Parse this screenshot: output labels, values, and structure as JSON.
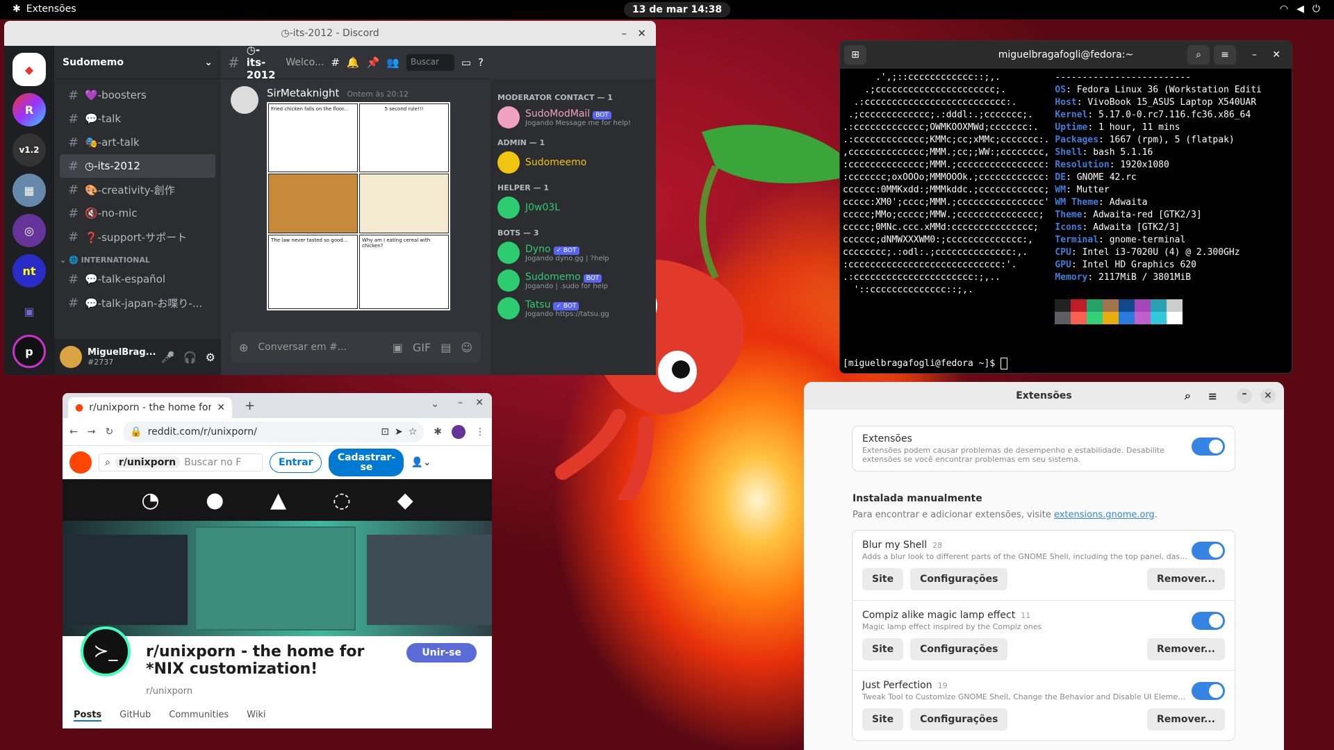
{
  "topbar": {
    "app": "Extensões",
    "clock": "13 de mar  14:38"
  },
  "discord": {
    "title": "◷-its-2012 - Discord",
    "guild": "Sudomemo",
    "channels": [
      "💜-boosters",
      "💬-talk",
      "🎭-art-talk",
      "◷-its-2012",
      "🎨-creativity-創作",
      "🔇-no-mic",
      "❓-support-サポート"
    ],
    "category": "INTERNATIONAL",
    "channels2": [
      "💬-talk-español",
      "💬-talk-japan-お喋り-..."
    ],
    "user": {
      "name": "MiguelBrag...",
      "tag": "#2737"
    },
    "header_channel": "◷-its-2012",
    "header_topic": "Welco...",
    "search": "Buscar",
    "message": {
      "author": "SirMetaknight",
      "time": "Ontem às 20:12"
    },
    "comic": [
      "Fried chicken falls on the floor...",
      "5 second rule!!!",
      "The law never tasted so good...",
      "Why am I eating cereal with chicken?"
    ],
    "input": "Conversar em #...",
    "members": [
      {
        "group": "MODERATOR CONTACT — 1",
        "name": "SudoModMail",
        "bot": "BOT",
        "status": "Jogando Message me for help!",
        "color": "#f0a0c0"
      },
      {
        "group": "ADMIN — 1",
        "name": "Sudomeemo",
        "color": "#f1c40f"
      },
      {
        "group": "HELPER — 1",
        "name": "J0w03L",
        "color": "#2ecc71"
      },
      {
        "group": "BOTS — 3",
        "name": "Dyno",
        "bot": "✓ BOT",
        "status": "Jogando dyno.gg | ?help",
        "color": "#2ecc71"
      },
      {
        "name": "Sudomemo",
        "bot": "BOT",
        "status": "Jogando | .sudo for help",
        "color": "#2ecc71"
      },
      {
        "name": "Tatsu",
        "bot": "✓ BOT",
        "status": "Jogando https://tatsu.gg",
        "color": "#2ecc71"
      }
    ]
  },
  "terminal": {
    "title": "miguelbragafogli@fedora:~",
    "info": [
      [
        "",
        ""
      ],
      [
        "OS",
        "Fedora Linux 36 (Workstation Editi"
      ],
      [
        "Host",
        "VivoBook 15_ASUS Laptop X540UAR"
      ],
      [
        "Kernel",
        "5.17.0-0.rc7.116.fc36.x86_64"
      ],
      [
        "Uptime",
        "1 hour, 11 mins"
      ],
      [
        "Packages",
        "1667 (rpm), 5 (flatpak)"
      ],
      [
        "Shell",
        "bash 5.1.16"
      ],
      [
        "Resolution",
        "1920x1080"
      ],
      [
        "DE",
        "GNOME 42.rc"
      ],
      [
        "WM",
        "Mutter"
      ],
      [
        "WM Theme",
        "Adwaita"
      ],
      [
        "Theme",
        "Adwaita-red [GTK2/3]"
      ],
      [
        "Icons",
        "Adwaita [GTK2/3]"
      ],
      [
        "Terminal",
        "gnome-terminal"
      ],
      [
        "CPU",
        "Intel i3-7020U (4) @ 2.300GHz"
      ],
      [
        "GPU",
        "Intel HD Graphics 620"
      ],
      [
        "Memory",
        "2117MiB / 3801MiB"
      ]
    ],
    "prompt": "[miguelbragafogli@fedora ~]$ "
  },
  "chrome": {
    "tab": "r/unixporn - the home for",
    "url": "reddit.com/r/unixporn/",
    "search_sub": "r/unixporn",
    "search_ph": "Buscar no F",
    "login": "Entrar",
    "signup": "Cadastrar-se",
    "sub_title": "r/unixporn - the home for *NIX customization!",
    "sub_name": "r/unixporn",
    "join": "Unir-se",
    "nav": [
      "Posts",
      "GitHub",
      "Communities",
      "Wiki"
    ]
  },
  "ext": {
    "title": "Extensões",
    "main_title": "Extensões",
    "main_desc": "Extensões podem causar problemas de desempenho e estabilidade. Desabilite extensões se você encontrar problemas em seu sistema.",
    "section": "Instalada manualmente",
    "section_desc": "Para encontrar e adicionar extensões, visite ",
    "section_link": "extensions.gnome.org",
    "items": [
      {
        "name": "Blur my Shell",
        "ver": "28",
        "desc": "Adds a blur look to different parts of the GNOME Shell, including the top panel, dash ..."
      },
      {
        "name": "Compiz alike magic lamp effect",
        "ver": "11",
        "desc": "Magic lamp effect inspired by the Compiz ones"
      },
      {
        "name": "Just Perfection",
        "ver": "19",
        "desc": "Tweak Tool to Customize GNOME Shell, Change the Behavior and Disable UI Elements"
      }
    ],
    "btn_site": "Site",
    "btn_conf": "Configurações",
    "btn_remove": "Remover..."
  }
}
